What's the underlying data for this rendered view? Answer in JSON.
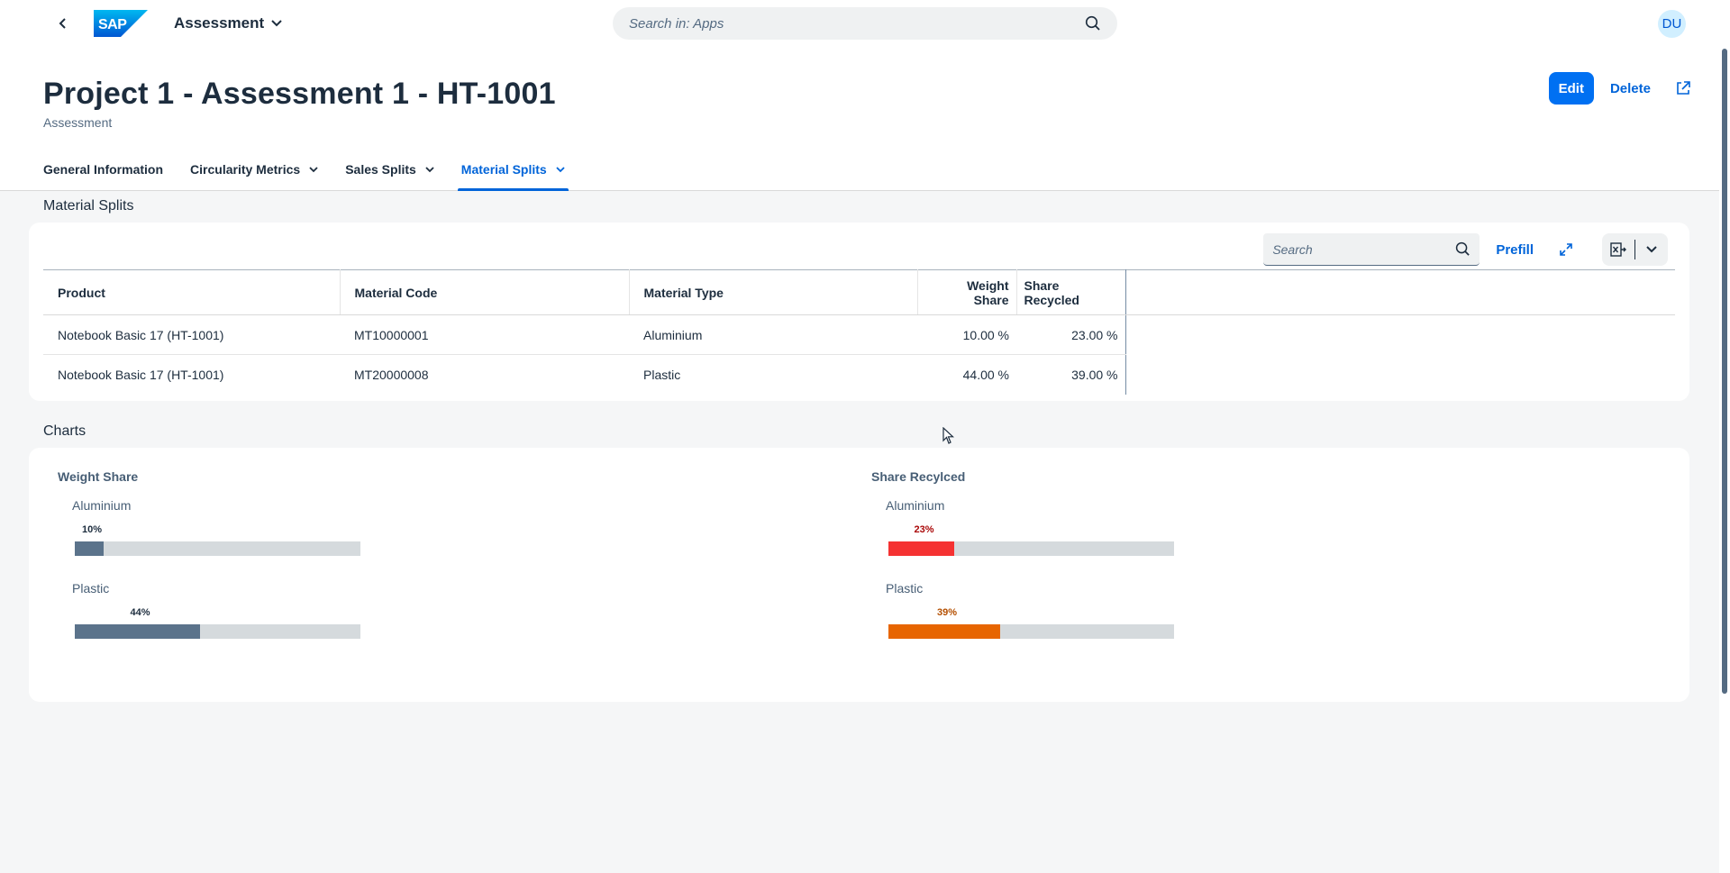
{
  "shell": {
    "app_title": "Assessment",
    "search_placeholder": "Search in: Apps",
    "avatar_initials": "DU"
  },
  "header": {
    "title": "Project 1 - Assessment 1 - HT-1001",
    "subtitle": "Assessment",
    "actions": {
      "edit": "Edit",
      "delete": "Delete"
    }
  },
  "tabs": [
    {
      "label": "General Information",
      "has_menu": false
    },
    {
      "label": "Circularity Metrics",
      "has_menu": true
    },
    {
      "label": "Sales Splits",
      "has_menu": true
    },
    {
      "label": "Material Splits",
      "has_menu": true,
      "active": true
    }
  ],
  "material_splits": {
    "section_title": "Material Splits",
    "toolbar": {
      "search_placeholder": "Search",
      "prefill": "Prefill"
    },
    "columns": [
      "Product",
      "Material Code",
      "Material Type",
      "Weight Share",
      "Share Recycled"
    ],
    "rows": [
      [
        "Notebook Basic 17 (HT-1001)",
        "MT10000001",
        "Aluminium",
        "10.00 %",
        "23.00 %"
      ],
      [
        "Notebook Basic 17 (HT-1001)",
        "MT20000008",
        "Plastic",
        "44.00 %",
        "39.00 %"
      ]
    ]
  },
  "charts_section": {
    "title": "Charts"
  },
  "chart_data": [
    {
      "type": "bar",
      "title": "Weight Share",
      "categories": [
        "Aluminium",
        "Plastic"
      ],
      "values": [
        10,
        44
      ],
      "value_labels": [
        "10%",
        "44%"
      ],
      "ylim": [
        0,
        100
      ],
      "colors": [
        "#5b738b",
        "#5b738b"
      ],
      "label_colors": [
        "#1d2d3e",
        "#1d2d3e"
      ]
    },
    {
      "type": "bar",
      "title": "Share Recylced",
      "categories": [
        "Aluminium",
        "Plastic"
      ],
      "values": [
        23,
        39
      ],
      "value_labels": [
        "23%",
        "39%"
      ],
      "ylim": [
        0,
        100
      ],
      "colors": [
        "#f53232",
        "#e76500"
      ],
      "label_colors": [
        "#aa0808",
        "#b44f00"
      ]
    }
  ],
  "colors": {
    "brand": "#0070f2",
    "link": "#0064d9",
    "text": "#1d2d3e",
    "track": "#d5dadd"
  }
}
